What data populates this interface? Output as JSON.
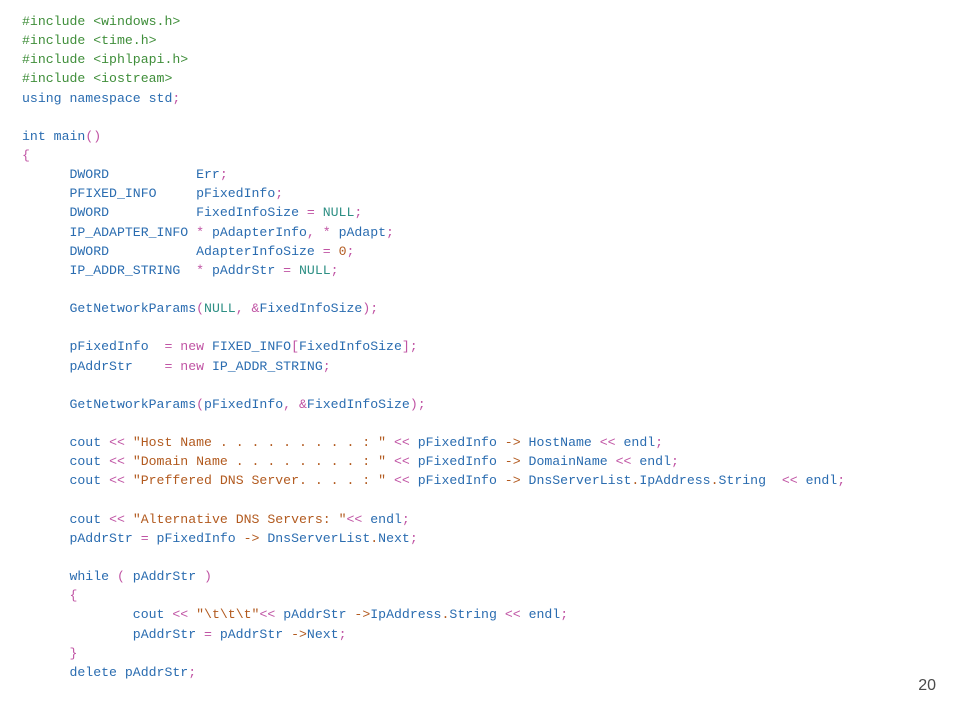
{
  "page_number": "20",
  "code": {
    "inc1a": "#include ",
    "inc1b": "<windows.h>",
    "inc2a": "#include ",
    "inc2b": "<time.h>",
    "inc3a": "#include ",
    "inc3b": "<iphlpapi.h>",
    "inc4a": "#include ",
    "inc4b": "<iostream>",
    "using1": "using namespace ",
    "using2": "std",
    "using3": ";",
    "blank1": "",
    "fn1a": "int ",
    "fn1b": "main",
    "fn1c": "()",
    "brace_open": "{",
    "d1a": "      DWORD           Err",
    "d1b": ";",
    "d2a": "      PFIXED_INFO     pFixedInfo",
    "d2b": ";",
    "d3a": "      DWORD           FixedInfoSize ",
    "d3b": "= ",
    "d3c": "NULL",
    "d3d": ";",
    "d4a": "      IP_ADAPTER_INFO ",
    "d4b": "* ",
    "d4c": "pAdapterInfo",
    "d4d": ", * ",
    "d4e": "pAdapt",
    "d4f": ";",
    "d5a": "      DWORD           AdapterInfoSize ",
    "d5b": "= ",
    "d5c": "0",
    "d5d": ";",
    "d6a": "      IP_ADDR_STRING  ",
    "d6b": "* ",
    "d6c": "pAddrStr ",
    "d6d": "= ",
    "d6e": "NULL",
    "d6f": ";",
    "blank2": "",
    "s1a": "      GetNetworkParams",
    "s1b": "(",
    "s1c": "NULL",
    "s1d": ", &",
    "s1e": "FixedInfoSize",
    "s1f": ");",
    "blank3": "",
    "s2a": "      pFixedInfo  ",
    "s2b": "= new ",
    "s2c": "FIXED_INFO",
    "s2d": "[",
    "s2e": "FixedInfoSize",
    "s2f": "];",
    "s3a": "      pAddrStr    ",
    "s3b": "= new ",
    "s3c": "IP_ADDR_STRING",
    "s3d": ";",
    "blank4": "",
    "s4a": "      GetNetworkParams",
    "s4b": "(",
    "s4c": "pFixedInfo",
    "s4d": ", &",
    "s4e": "FixedInfoSize",
    "s4f": ");",
    "blank5": "",
    "c1a": "      cout ",
    "c1b": "<< ",
    "c1c": "\"Host Name . . . . . . . . . : \" ",
    "c1d": "<< ",
    "c1e": "pFixedInfo ",
    "c1f": "-> ",
    "c1g": "HostName ",
    "c1h": "<< ",
    "c1i": "endl",
    "c1j": ";",
    "c2a": "      cout ",
    "c2b": "<< ",
    "c2c": "\"Domain Name . . . . . . . . : \" ",
    "c2d": "<< ",
    "c2e": "pFixedInfo ",
    "c2f": "-> ",
    "c2g": "DomainName ",
    "c2h": "<< ",
    "c2i": "endl",
    "c2j": ";",
    "c3a": "      cout ",
    "c3b": "<< ",
    "c3c": "\"Preffered DNS Server. . . . : \" ",
    "c3d": "<< ",
    "c3e": "pFixedInfo ",
    "c3f": "-> ",
    "c3g": "DnsServerList",
    "c3h": ".",
    "c3i": "IpAddress",
    "c3j": ".",
    "c3k": "String  ",
    "c3l": "<< ",
    "c3m": "endl",
    "c3n": ";",
    "blank6": "",
    "c4a": "      cout ",
    "c4b": "<< ",
    "c4c": "\"Alternative DNS Servers: \"",
    "c4d": "<< ",
    "c4e": "endl",
    "c4f": ";",
    "s5a": "      pAddrStr ",
    "s5b": "= ",
    "s5c": "pFixedInfo ",
    "s5d": "-> ",
    "s5e": "DnsServerList",
    "s5f": ".",
    "s5g": "Next",
    "s5h": ";",
    "blank7": "",
    "w1a": "      while ",
    "w1b": "( ",
    "w1c": "pAddrStr ",
    "w1d": ")",
    "w2": "      {",
    "w3a": "              cout ",
    "w3b": "<< ",
    "w3c": "\"\\t\\t\\t\"",
    "w3d": "<< ",
    "w3e": "pAddrStr ",
    "w3f": "->",
    "w3g": "IpAddress",
    "w3h": ".",
    "w3i": "String ",
    "w3j": "<< ",
    "w3k": "endl",
    "w3l": ";",
    "w4a": "              pAddrStr ",
    "w4b": "= ",
    "w4c": "pAddrStr ",
    "w4d": "->",
    "w4e": "Next",
    "w4f": ";",
    "w5": "      }",
    "del1a": "      delete ",
    "del1b": "pAddrStr",
    "del1c": ";"
  }
}
